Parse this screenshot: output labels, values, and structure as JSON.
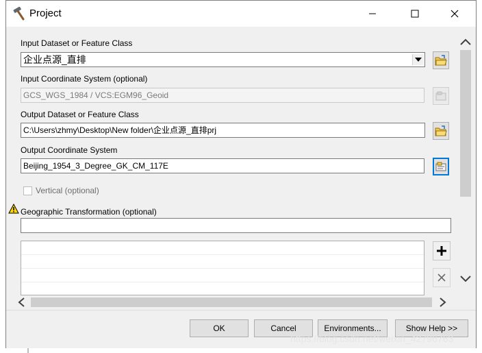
{
  "window": {
    "title": "Project",
    "title_icon": "hammer-icon",
    "controls": [
      "minimize-icon",
      "maximize-icon",
      "close-icon"
    ]
  },
  "form": {
    "input_dataset": {
      "label": "Input Dataset or Feature Class",
      "value": "企业点源_直排",
      "control": "dropdown"
    },
    "input_coord": {
      "label": "Input Coordinate System (optional)",
      "value": "GCS_WGS_1984 / VCS:EGM96_Geoid",
      "disabled": true
    },
    "output_dataset": {
      "label": "Output Dataset or Feature Class",
      "value": "C:\\Users\\zhmy\\Desktop\\New folder\\企业点源_直排prj"
    },
    "output_coord": {
      "label": "Output Coordinate System",
      "value": "Beijing_1954_3_Degree_GK_CM_117E"
    },
    "vertical": {
      "label": "Vertical (optional)",
      "checked": false,
      "disabled": true
    },
    "geo_transform": {
      "label": "Geographic Transformation (optional)",
      "value": "",
      "warning_icon": "warning-icon"
    }
  },
  "list_buttons": {
    "add_icon": "plus-icon",
    "remove_icon": "x-icon"
  },
  "buttons": {
    "ok": "OK",
    "cancel": "Cancel",
    "environments": "Environments...",
    "show_help": "Show Help >>"
  },
  "watermark": "https://blog.csdn.net/weixin_42796763",
  "colors": {
    "focus": "#0078d7",
    "window_bg": "#f0f0f0",
    "warning": "#ffd800"
  }
}
